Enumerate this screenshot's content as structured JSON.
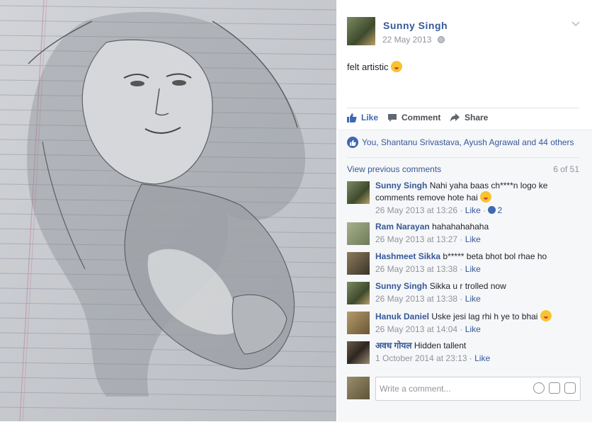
{
  "post": {
    "author": "Sunny Singh",
    "date": "22 May 2013",
    "text": "felt artistic"
  },
  "actions": {
    "like": "Like",
    "comment": "Comment",
    "share": "Share"
  },
  "likes_summary": "You, Shantanu Srivastava, Ayush Agrawal and 44 others",
  "view_previous": "View previous comments",
  "comment_count": "6 of 51",
  "comments": [
    {
      "name": "Sunny Singh",
      "text": "Nahi yaha baas ch****n logo ke comments remove hote hai",
      "time": "26 May 2013 at 13:26",
      "like": "Like",
      "reactions": "2"
    },
    {
      "name": "Ram Narayan",
      "text": "hahahahahaha",
      "time": "26 May 2013 at 13:27",
      "like": "Like"
    },
    {
      "name": "Hashmeet Sikka",
      "text": "b***** beta bhot bol rhae ho",
      "time": "26 May 2013 at 13:38",
      "like": "Like"
    },
    {
      "name": "Sunny Singh",
      "text": "Sikka u r trolled now",
      "time": "26 May 2013 at 13:38",
      "like": "Like"
    },
    {
      "name": "Hanuk Daniel",
      "text": "Uske jesi lag rhi h ye to bhai",
      "time": "26 May 2013 at 14:04",
      "like": "Like"
    },
    {
      "name": "अवध गोयल",
      "text": "Hidden tallent",
      "time": "1 October 2014 at 23:13",
      "like": "Like"
    }
  ],
  "reply_placeholder": "Write a comment...",
  "colors": {
    "link": "#365899",
    "like_blue": "#4267b2",
    "muted": "#90949c"
  }
}
